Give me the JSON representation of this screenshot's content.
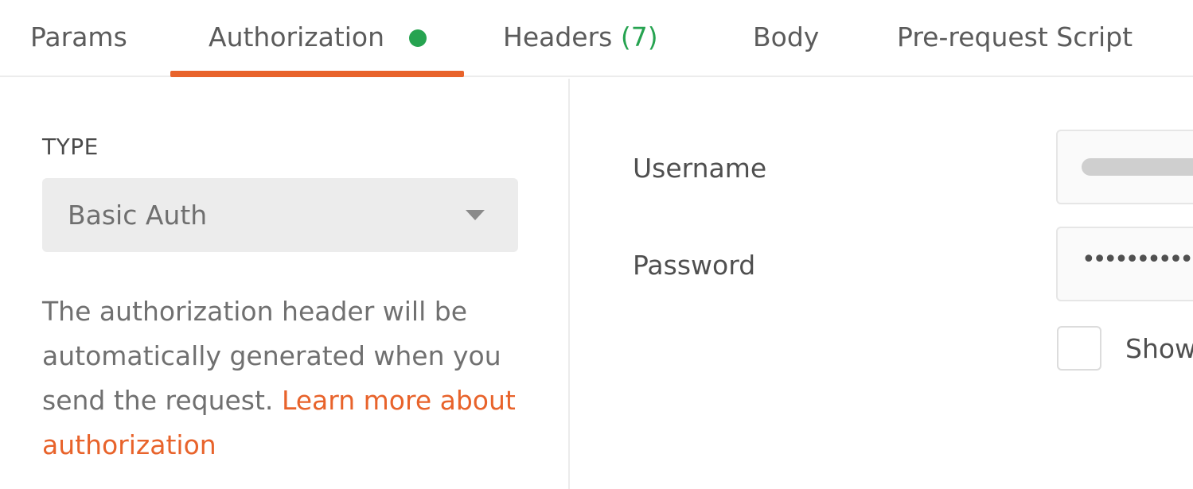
{
  "tabs": [
    {
      "label": "Params"
    },
    {
      "label": "Authorization"
    },
    {
      "label": "Headers",
      "count": "(7)"
    },
    {
      "label": "Body"
    },
    {
      "label": "Pre-request Script"
    }
  ],
  "active_tab": "Authorization",
  "colors": {
    "accent": "#e8632b",
    "status_dot": "#26a350",
    "count": "#26a350"
  },
  "auth": {
    "type_heading": "TYPE",
    "type_value": "Basic Auth",
    "description": "The authorization header will be automatically generated when you send the request.",
    "learn_more": "Learn more about authorization"
  },
  "fields": {
    "username_label": "Username",
    "password_label": "Password",
    "password_value": "••••••••••••",
    "show_password_label": "Show"
  },
  "icons": {
    "status": "status-dot-icon",
    "dropdown": "chevron-down-icon"
  }
}
